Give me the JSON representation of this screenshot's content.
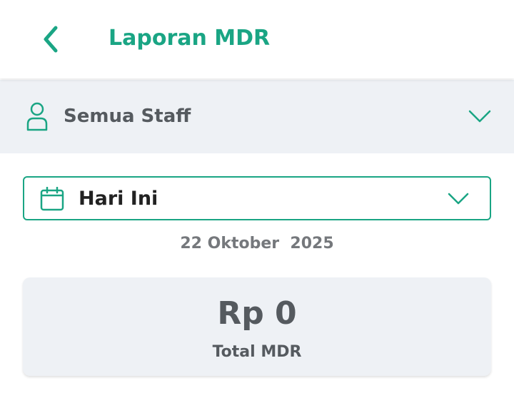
{
  "header": {
    "title": "Laporan MDR",
    "back_icon": "chevron-left-icon"
  },
  "staff_filter": {
    "label": "Semua Staff",
    "icon": "user-icon",
    "dropdown_icon": "chevron-down-icon"
  },
  "period_filter": {
    "selected": "Hari Ini",
    "icon": "calendar-icon",
    "dropdown_icon": "chevron-down-icon"
  },
  "date_display": "22 Oktober  2025",
  "summary": {
    "amount": "Rp 0",
    "label": "Total MDR"
  },
  "colors": {
    "accent": "#1aa584",
    "text_dark": "#555a5f",
    "background_gray": "#eef1f5"
  }
}
